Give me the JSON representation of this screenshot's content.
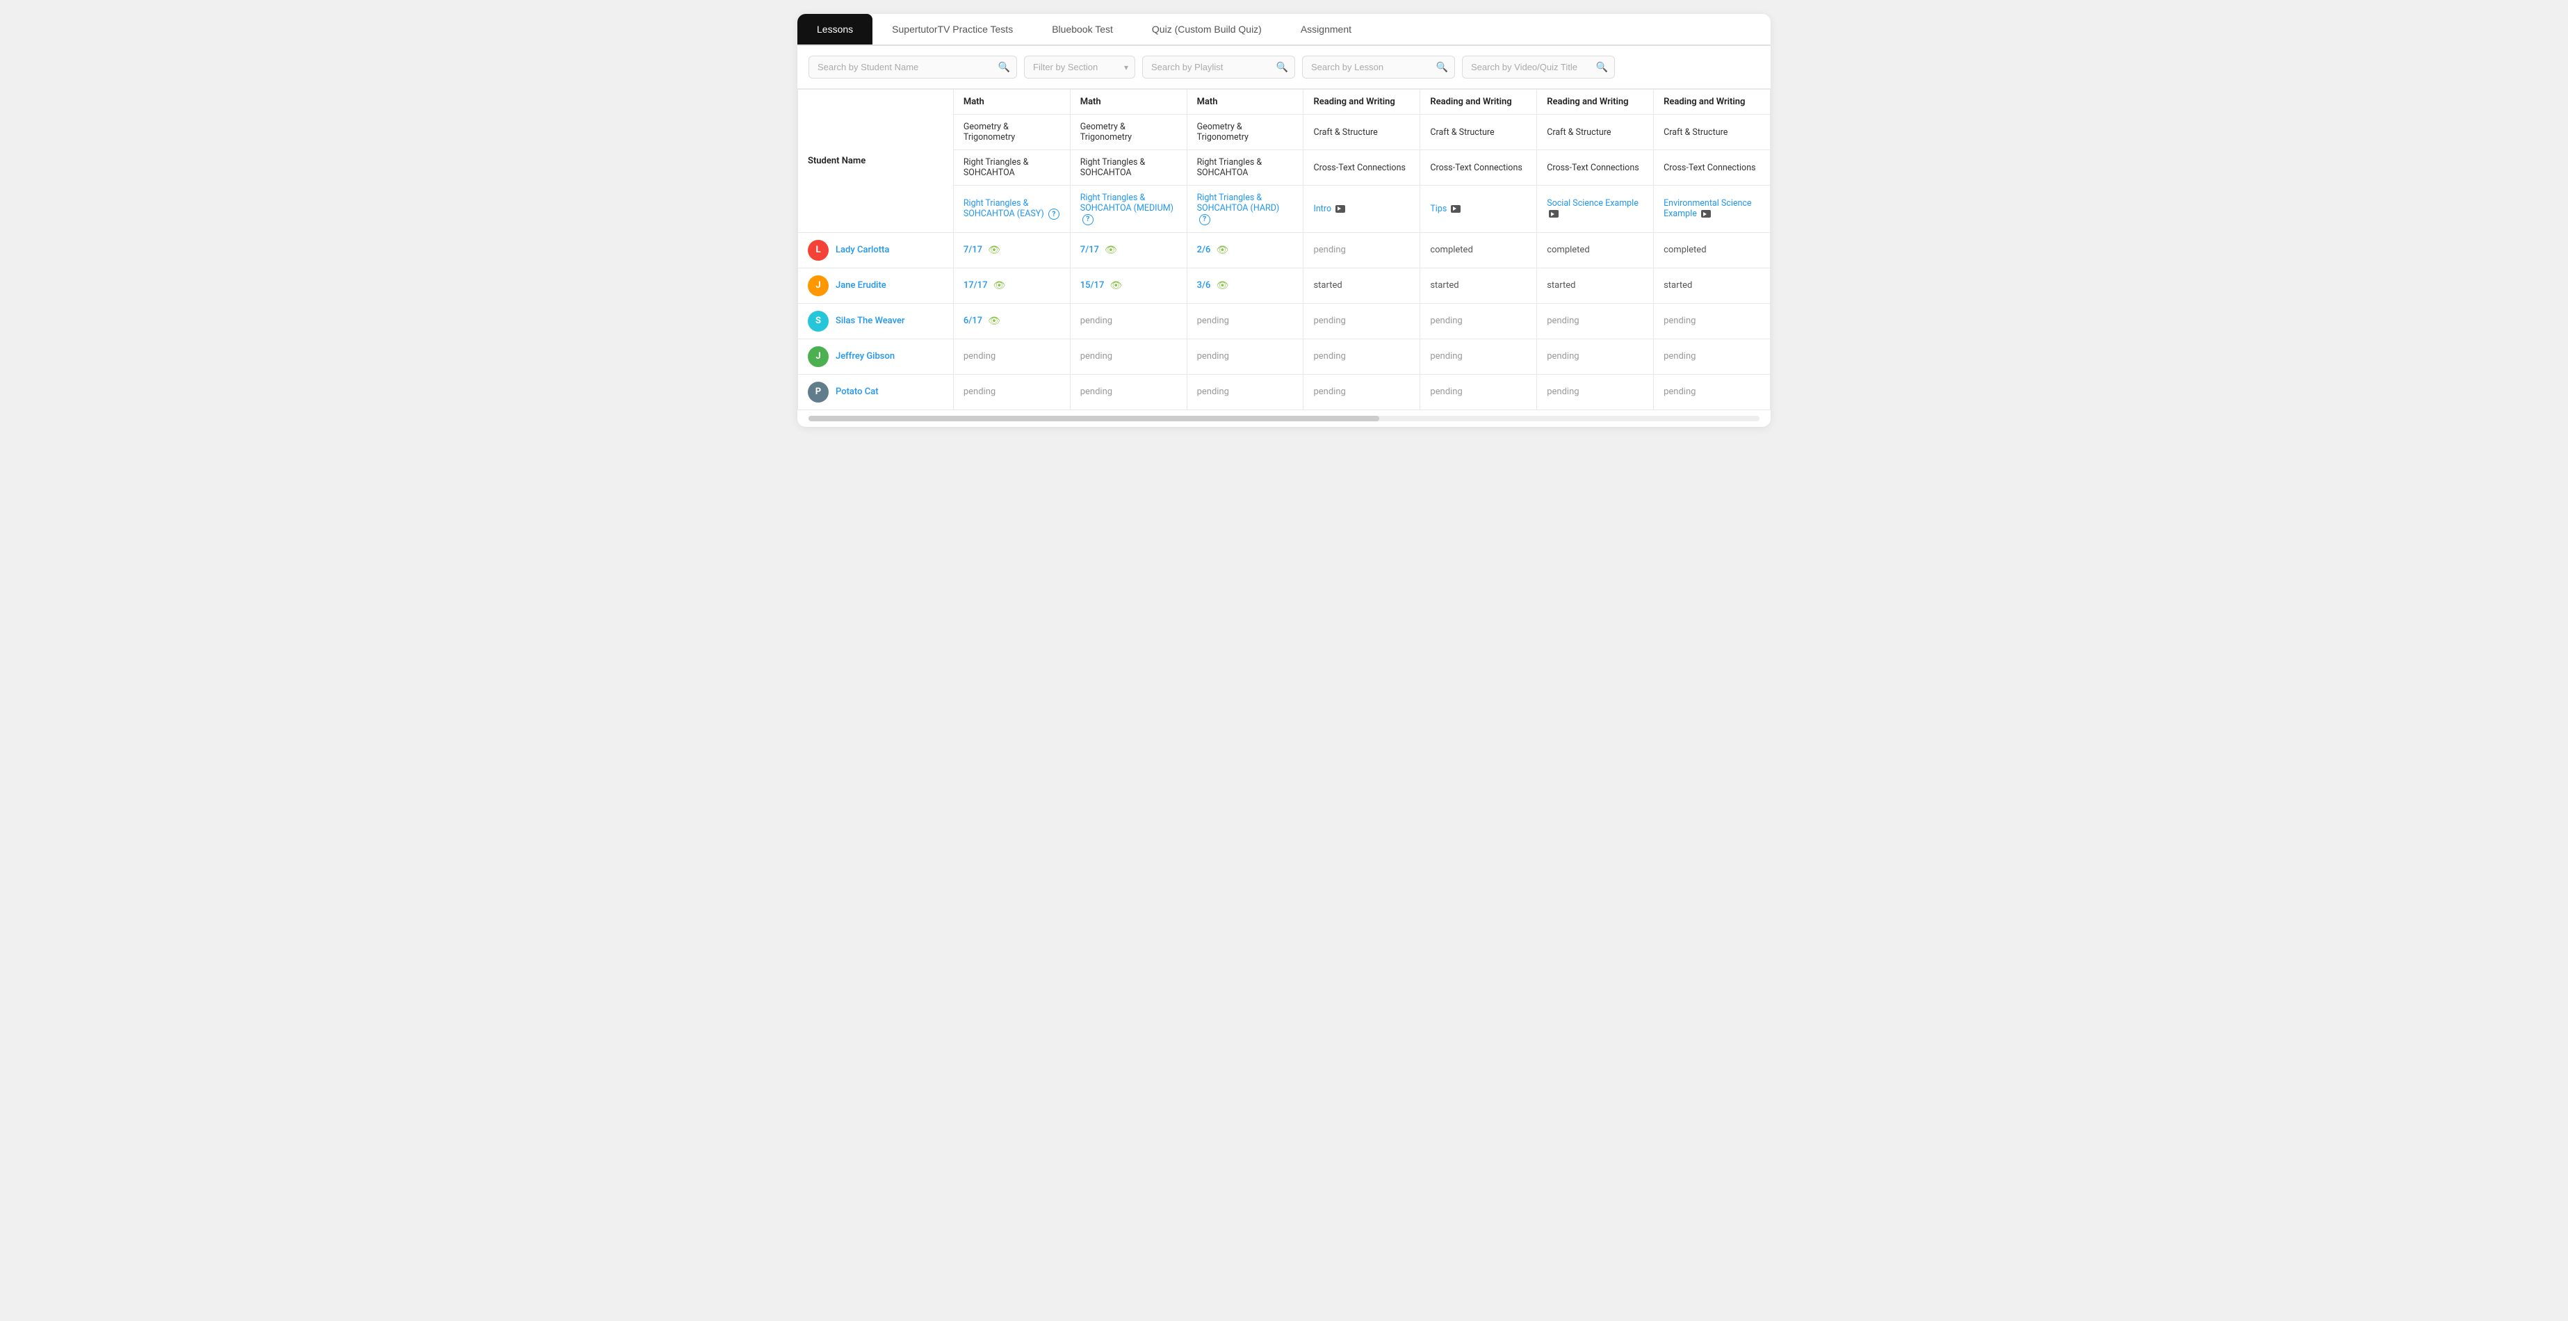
{
  "tabs": [
    {
      "id": "lessons",
      "label": "Lessons",
      "active": true
    },
    {
      "id": "supertutor",
      "label": "SupertutorTV Practice Tests",
      "active": false
    },
    {
      "id": "bluebook",
      "label": "Bluebook Test",
      "active": false
    },
    {
      "id": "quiz",
      "label": "Quiz (Custom Build Quiz)",
      "active": false
    },
    {
      "id": "assignment",
      "label": "Assignment",
      "active": false
    }
  ],
  "search": {
    "student_placeholder": "Search by Student Name",
    "filter_placeholder": "Filter by Section",
    "playlist_placeholder": "Search by Playlist",
    "lesson_placeholder": "Search by Lesson",
    "video_placeholder": "Search by Video/Quiz Title"
  },
  "table": {
    "student_name_header": "Student Name",
    "columns": [
      {
        "subject": "Math",
        "domain": "Geometry & Trigonometry",
        "topic": "Right Triangles & SOHCAHTOA",
        "lesson": "Right Triangles & SOHCAHTOA (EASY)",
        "has_question": true,
        "has_video": false
      },
      {
        "subject": "Math",
        "domain": "Geometry & Trigonometry",
        "topic": "Right Triangles & SOHCAHTOA",
        "lesson": "Right Triangles & SOHCAHTOA (MEDIUM)",
        "has_question": true,
        "has_video": false
      },
      {
        "subject": "Math",
        "domain": "Geometry & Trigonometry",
        "topic": "Right Triangles & SOHCAHTOA",
        "lesson": "Right Triangles & SOHCAHTOA (HARD)",
        "has_question": true,
        "has_video": false
      },
      {
        "subject": "Reading and Writing",
        "domain": "Craft & Structure",
        "topic": "Cross-Text Connections",
        "lesson": "Intro",
        "has_question": false,
        "has_video": true
      },
      {
        "subject": "Reading and Writing",
        "domain": "Craft & Structure",
        "topic": "Cross-Text Connections",
        "lesson": "Tips",
        "has_question": false,
        "has_video": true
      },
      {
        "subject": "Reading and Writing",
        "domain": "Craft & Structure",
        "topic": "Cross-Text Connections",
        "lesson": "Social Science Example",
        "has_question": false,
        "has_video": true
      },
      {
        "subject": "Reading and Writing",
        "domain": "Craft & Structure",
        "topic": "Cross-Text Connections",
        "lesson": "Environmental Science Example",
        "has_question": false,
        "has_video": true
      }
    ],
    "students": [
      {
        "name": "Lady Carlotta",
        "avatar_letter": "L",
        "avatar_color": "#f44336",
        "scores": [
          "7/17",
          "7/17",
          "2/6",
          "pending",
          "completed",
          "completed",
          "completed"
        ]
      },
      {
        "name": "Jane Erudite",
        "avatar_letter": "J",
        "avatar_color": "#ff9800",
        "scores": [
          "17/17",
          "15/17",
          "3/6",
          "started",
          "started",
          "started",
          "started"
        ]
      },
      {
        "name": "Silas The Weaver",
        "avatar_letter": "S",
        "avatar_color": "#26c6da",
        "scores": [
          "6/17",
          "pending",
          "pending",
          "pending",
          "pending",
          "pending",
          "pending"
        ]
      },
      {
        "name": "Jeffrey Gibson",
        "avatar_letter": "J",
        "avatar_color": "#4caf50",
        "scores": [
          "pending",
          "pending",
          "pending",
          "pending",
          "pending",
          "pending",
          "pending"
        ]
      },
      {
        "name": "Potato Cat",
        "avatar_letter": "P",
        "avatar_color": "#607d8b",
        "scores": [
          "pending",
          "pending",
          "pending",
          "pending",
          "pending",
          "pending",
          "pending"
        ]
      }
    ]
  }
}
